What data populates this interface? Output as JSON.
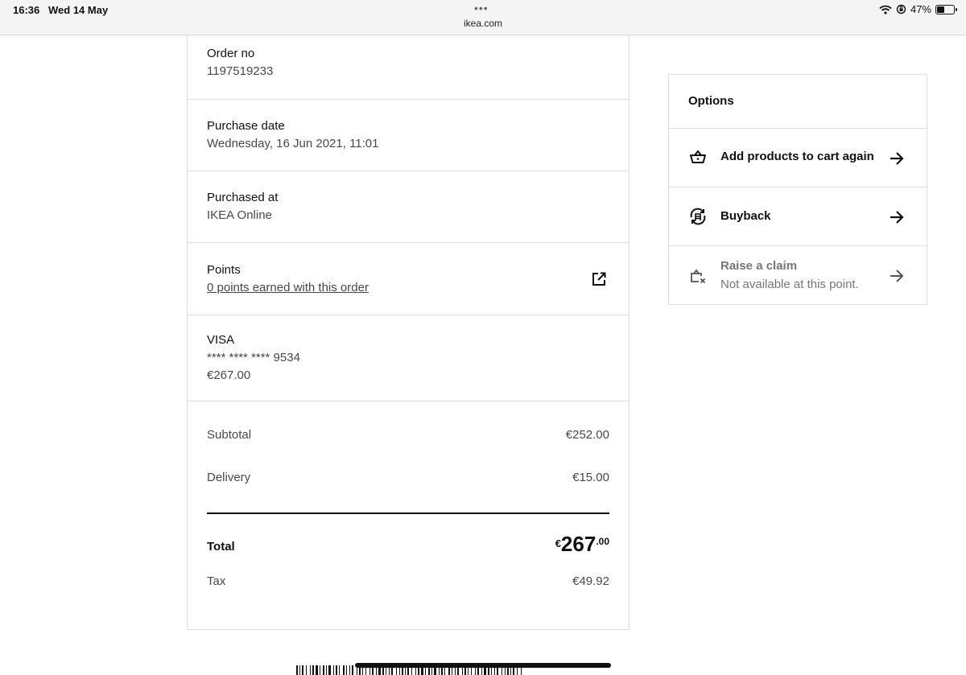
{
  "status_bar": {
    "time": "16:36",
    "date": "Wed 14 May",
    "dots": "•••",
    "url": "ikea.com",
    "battery_percent": "47%",
    "battery_level": 0.47
  },
  "order": {
    "order_no_label": "Order no",
    "order_no_value": "1197519233",
    "purchase_date_label": "Purchase date",
    "purchase_date_value": "Wednesday, 16 Jun 2021, 11:01",
    "purchased_at_label": "Purchased at",
    "purchased_at_value": "IKEA Online",
    "points_label": "Points",
    "points_link": "0 points earned with this order",
    "payment_method": "VISA",
    "card_number": "**** **** **** 9534",
    "payment_amount": "€267.00",
    "subtotal_label": "Subtotal",
    "subtotal_value": "€252.00",
    "delivery_label": "Delivery",
    "delivery_value": "€15.00",
    "total_label": "Total",
    "total_currency": "€",
    "total_integer": "267",
    "total_decimal": ".00",
    "tax_label": "Tax",
    "tax_value": "€49.92"
  },
  "options": {
    "title": "Options",
    "items": [
      {
        "label": "Add products to cart again",
        "icon": "basket-icon",
        "enabled": true
      },
      {
        "label": "Buyback",
        "icon": "buyback-icon",
        "enabled": true
      },
      {
        "label": "Raise a claim",
        "sub": "Not available at this point.",
        "icon": "claim-icon",
        "enabled": false
      }
    ]
  }
}
